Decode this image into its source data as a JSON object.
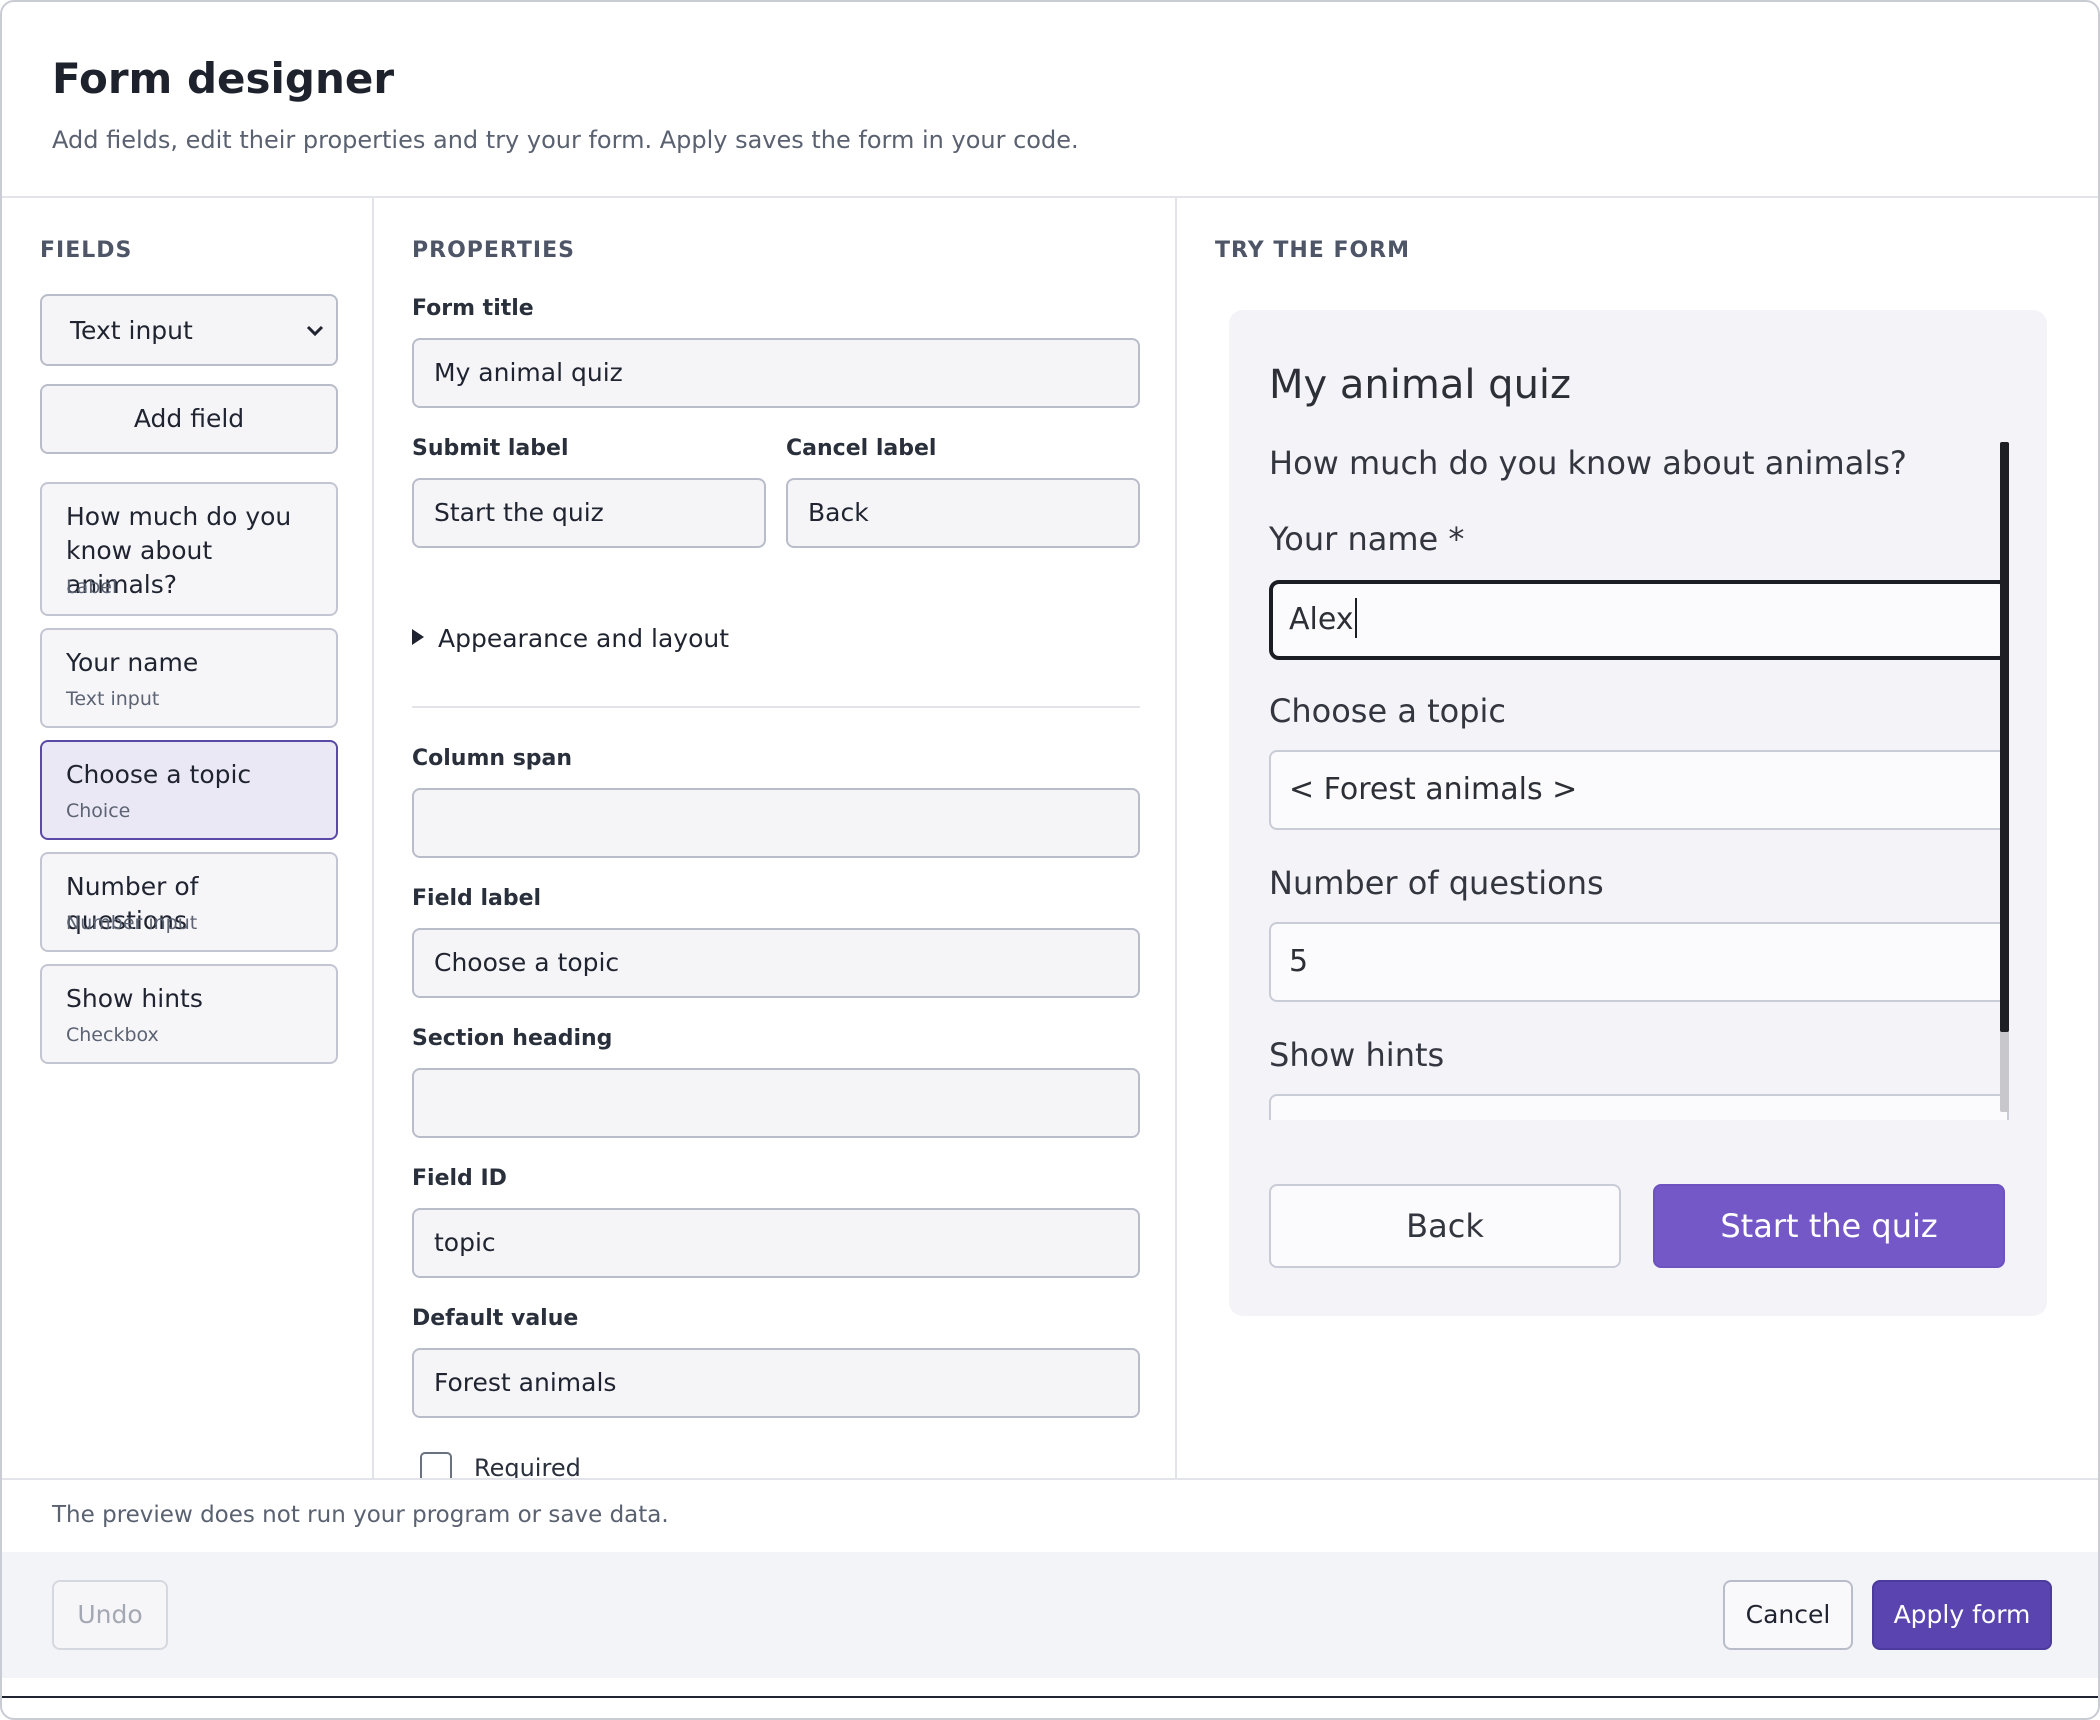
{
  "header": {
    "title": "Form designer",
    "subtitle": "Add fields, edit their properties and try your form. Apply saves the form in your code."
  },
  "fields_panel": {
    "heading": "FIELDS",
    "type_select_value": "Text input",
    "add_button": "Add field",
    "items": [
      {
        "name": "How much do you know about animals?",
        "type": "Label",
        "selected": false
      },
      {
        "name": "Your name",
        "type": "Text input",
        "selected": false
      },
      {
        "name": "Choose a topic",
        "type": "Choice",
        "selected": true
      },
      {
        "name": "Number of questions",
        "type": "Number input",
        "selected": false
      },
      {
        "name": "Show hints",
        "type": "Checkbox",
        "selected": false
      }
    ]
  },
  "properties": {
    "heading": "PROPERTIES",
    "form_title_label": "Form title",
    "form_title_value": "My animal quiz",
    "submit_label_label": "Submit label",
    "submit_label_value": "Start the quiz",
    "cancel_label_label": "Cancel label",
    "cancel_label_value": "Back",
    "appearance_toggle": "Appearance and layout",
    "column_span_label": "Column span",
    "column_span_value": "",
    "field_label_label": "Field label",
    "field_label_value": "Choose a topic",
    "section_heading_label": "Section heading",
    "section_heading_value": "",
    "field_id_label": "Field ID",
    "field_id_value": "topic",
    "default_value_label": "Default value",
    "default_value_value": "Forest animals",
    "required_label": "Required",
    "required_checked": false
  },
  "try_form": {
    "heading": "TRY THE FORM",
    "title": "My animal quiz",
    "section_heading": "How much do you know about animals?",
    "name_label": "Your name *",
    "name_value": "Alex",
    "topic_label": "Choose a topic",
    "topic_value": "< Forest animals >",
    "count_label": "Number of questions",
    "count_value": "5",
    "hints_label": "Show hints",
    "back_button": "Back",
    "start_button": "Start the quiz"
  },
  "footer": {
    "note": "The preview does not run your program or save data.",
    "undo": "Undo",
    "cancel": "Cancel",
    "apply": "Apply form"
  },
  "colors": {
    "accent": "#5a45b0",
    "preview_accent": "#7558c8",
    "selected_bg": "#ebe8f6"
  }
}
